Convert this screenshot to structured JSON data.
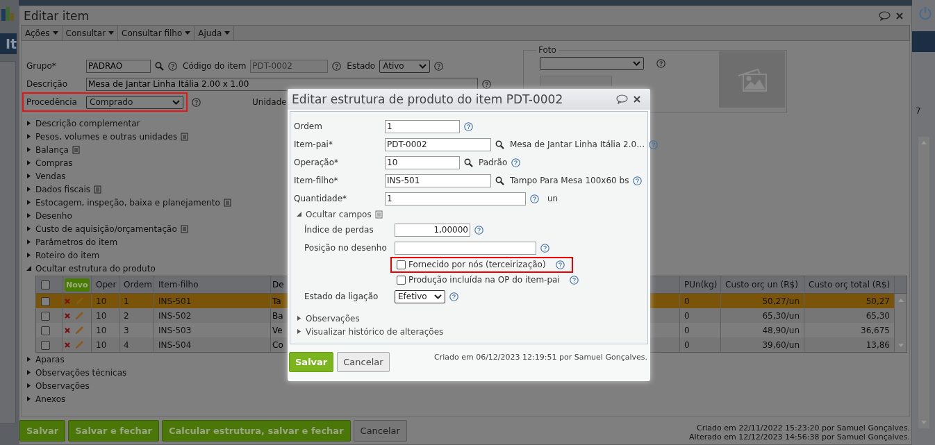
{
  "background": {
    "heading": "It",
    "counter": "7"
  },
  "window": {
    "title": "Editar item"
  },
  "menu": [
    {
      "label": "Ações"
    },
    {
      "label": "Consultar"
    },
    {
      "label": "Consultar filho"
    },
    {
      "label": "Ajuda"
    }
  ],
  "form": {
    "group": {
      "label": "Grupo*",
      "value": "PADRAO"
    },
    "code": {
      "label": "Código do item",
      "value": "PDT-0002",
      "disabled": true
    },
    "status": {
      "label": "Estado",
      "value": "Ativo"
    },
    "description": {
      "label": "Descrição",
      "value": "Mesa de Jantar Linha Itália 2.00 x 1.00"
    },
    "origin": {
      "label": "Procedência",
      "value": "Comprado",
      "highlighted": true
    },
    "unit": {
      "label": "Unidade"
    }
  },
  "photo": {
    "legend": "Foto"
  },
  "sections": [
    {
      "label": "Descrição complementar",
      "expanded": false,
      "note": false
    },
    {
      "label": "Pesos, volumes e outras unidades",
      "expanded": false,
      "note": true
    },
    {
      "label": "Balança",
      "expanded": false,
      "note": true
    },
    {
      "label": "Compras",
      "expanded": false,
      "note": false
    },
    {
      "label": "Vendas",
      "expanded": false,
      "note": false
    },
    {
      "label": "Dados fiscais",
      "expanded": false,
      "note": true
    },
    {
      "label": "Estocagem, inspeção, baixa e planejamento",
      "expanded": false,
      "note": true
    },
    {
      "label": "Desenho",
      "expanded": false,
      "note": false
    },
    {
      "label": "Custo de aquisição/orçamentação",
      "expanded": false,
      "note": true
    },
    {
      "label": "Parâmetros do item",
      "expanded": false,
      "note": false
    },
    {
      "label": "Roteiro do item",
      "expanded": false,
      "note": false
    },
    {
      "label": "Ocultar estrutura do produto",
      "expanded": true,
      "note": false,
      "table": {
        "new_button": "Novo",
        "header_checked": false,
        "columns": [
          "Oper",
          "Ordem",
          "Item-filho",
          "De",
          "PUn(kg)",
          "Custo orç un (R$)",
          "Custo orç total (R$)"
        ],
        "rows": [
          {
            "selected": true,
            "checked": false,
            "cells": [
              "10",
              "1",
              "INS-501",
              "Ta",
              "0",
              "50,27/un",
              "50,27"
            ]
          },
          {
            "selected": false,
            "checked": false,
            "cells": [
              "10",
              "2",
              "INS-502",
              "Ba",
              "0",
              "65,30/un",
              "65,30"
            ]
          },
          {
            "selected": false,
            "checked": false,
            "cells": [
              "10",
              "3",
              "INS-503",
              "Ve",
              "0",
              "48,90/un",
              "36,675"
            ]
          },
          {
            "selected": false,
            "checked": false,
            "cells": [
              "10",
              "4",
              "INS-504",
              "Co",
              "0",
              "39,60/un",
              "13,86"
            ]
          }
        ]
      }
    },
    {
      "label": "Aparas",
      "expanded": false,
      "note": false
    },
    {
      "label": "Observações técnicas",
      "expanded": false,
      "note": false
    },
    {
      "label": "Observações",
      "expanded": false,
      "note": false
    },
    {
      "label": "Anexos",
      "expanded": false,
      "note": false
    }
  ],
  "buttons": [
    {
      "label": "Salvar",
      "kind": "primary"
    },
    {
      "label": "Salvar e fechar",
      "kind": "primary"
    },
    {
      "label": "Calcular estrutura, salvar e fechar",
      "kind": "primary"
    },
    {
      "label": "Cancelar",
      "kind": "secondary"
    }
  ],
  "audit": [
    "Criado em 22/11/2022 15:23:20 por Samuel Gonçalves.",
    "Alterado em 12/12/2023 14:56:38 por Samuel Gonçalves."
  ],
  "dialog": {
    "title": "Editar estrutura de produto do item PDT-0002",
    "fields": [
      {
        "kind": "short",
        "label": "Ordem",
        "value": "1"
      },
      {
        "kind": "lookup",
        "label": "Item-pai*",
        "value": "PDT-0002",
        "info": "Mesa de Jantar Linha Itália 2.0…"
      },
      {
        "kind": "lookup_short",
        "label": "Operação*",
        "value": "10",
        "info": "Padrão"
      },
      {
        "kind": "lookup",
        "label": "Item-filho*",
        "value": "INS-501",
        "info": "Tampo Para Mesa 100x60 bs"
      },
      {
        "kind": "long",
        "label": "Quantidade*",
        "value": "1",
        "unit": "un"
      }
    ],
    "more": {
      "label": "Ocultar campos",
      "expanded": true,
      "note": true
    },
    "extra": [
      {
        "kind": "number",
        "label": "Índice de perdas",
        "value": "1,00000"
      },
      {
        "kind": "text",
        "label": "Posição no desenho"
      },
      {
        "kind": "checkbox",
        "label": "Fornecido por nós (terceirização)",
        "checked": false,
        "highlighted": true
      },
      {
        "kind": "checkbox",
        "label": "Produção incluída na OP do item-pai",
        "checked": false,
        "highlighted": false
      },
      {
        "kind": "select",
        "label": "Estado da ligação",
        "value": "Efetivo"
      }
    ],
    "sections": [
      {
        "label": "Observações",
        "expanded": false
      },
      {
        "label": "Visualizar histórico de alterações",
        "expanded": false
      }
    ],
    "buttons": [
      {
        "label": "Salvar",
        "kind": "primary"
      },
      {
        "label": "Cancelar",
        "kind": "secondary"
      }
    ],
    "audit": "Criado em 06/12/2023 12:19:51 por Samuel Gonçalves."
  }
}
